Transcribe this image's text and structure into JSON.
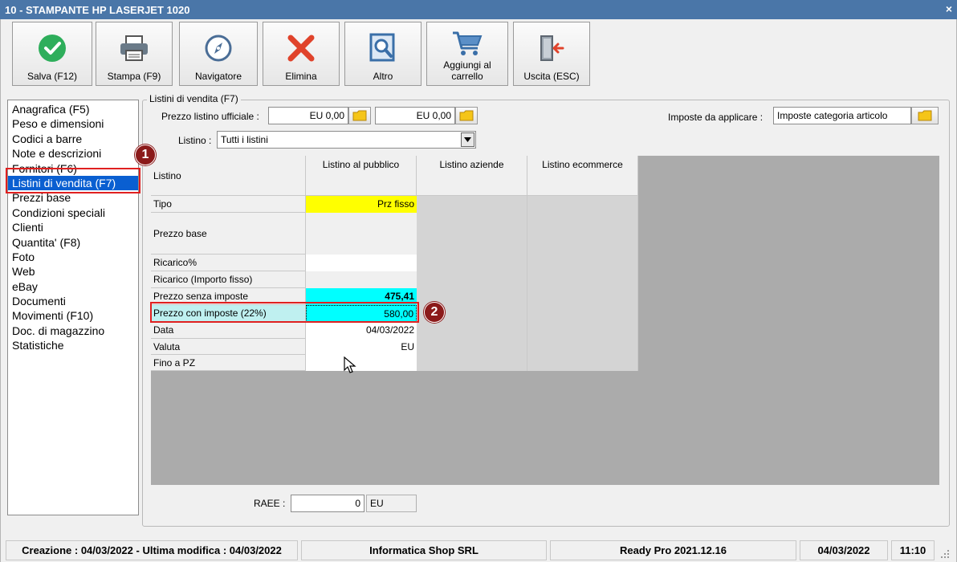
{
  "window": {
    "title": "10 - STAMPANTE HP LASERJET 1020",
    "close": "×"
  },
  "toolbar": {
    "save": "Salva (F12)",
    "print": "Stampa (F9)",
    "navigator": "Navigatore",
    "delete": "Elimina",
    "other": "Altro",
    "cart_line1": "Aggiungi al",
    "cart_line2": "carrello",
    "exit": "Uscita (ESC)"
  },
  "sidebar": {
    "items": [
      "Anagrafica (F5)",
      "Peso e dimensioni",
      "Codici a barre",
      "Note e descrizioni",
      "Fornitori (F6)",
      "Listini di vendita (F7)",
      "Prezzi base",
      "Condizioni speciali",
      "Clienti",
      "Quantita' (F8)",
      "Foto",
      "Web",
      "eBay",
      "Documenti",
      "Movimenti (F10)",
      "Doc. di magazzino",
      "Statistiche"
    ],
    "selected_index": 5
  },
  "listini": {
    "group_title": "Listini di vendita (F7)",
    "official_price_label": "Prezzo listino ufficiale :",
    "official_price_1": "EU 0,00",
    "official_price_2": "EU 0,00",
    "taxes_label": "Imposte da applicare :",
    "taxes_value": "Imposte categoria articolo",
    "listino_label": "Listino :",
    "listino_value": "Tutti i listini"
  },
  "grid": {
    "corner": "Listino",
    "columns": [
      "Listino al pubblico",
      "Listino aziende",
      "Listino ecommerce"
    ],
    "rows": [
      {
        "label": "Tipo",
        "value": "Prz fisso"
      },
      {
        "label": "Prezzo base",
        "value": ""
      },
      {
        "label": "Ricarico%",
        "value": ""
      },
      {
        "label": "Ricarico (Importo fisso)",
        "value": ""
      },
      {
        "label": "Prezzo senza imposte",
        "value": "475,41"
      },
      {
        "label": "Prezzo con imposte (22%)",
        "value": "580,00"
      },
      {
        "label": "Data",
        "value": "04/03/2022"
      },
      {
        "label": "Valuta",
        "value": "EU"
      },
      {
        "label": "Fino a PZ",
        "value": ""
      }
    ]
  },
  "raee": {
    "label": "RAEE :",
    "value": "0",
    "currency": "EU"
  },
  "annotations": {
    "callout1": "1",
    "callout2": "2"
  },
  "statusbar": {
    "created": "Creazione : 04/03/2022 - Ultima modifica : 04/03/2022",
    "company": "Informatica Shop SRL",
    "version": "Ready Pro 2021.12.16",
    "date": "04/03/2022",
    "time": "11:10"
  },
  "colors": {
    "titlebar": "#4a76a8",
    "selection": "#0a5fd1",
    "yellow_cell": "#ffff00",
    "cyan_cell": "#00ffff",
    "callout": "#8b1a1a",
    "highlight_box": "#e02020"
  }
}
